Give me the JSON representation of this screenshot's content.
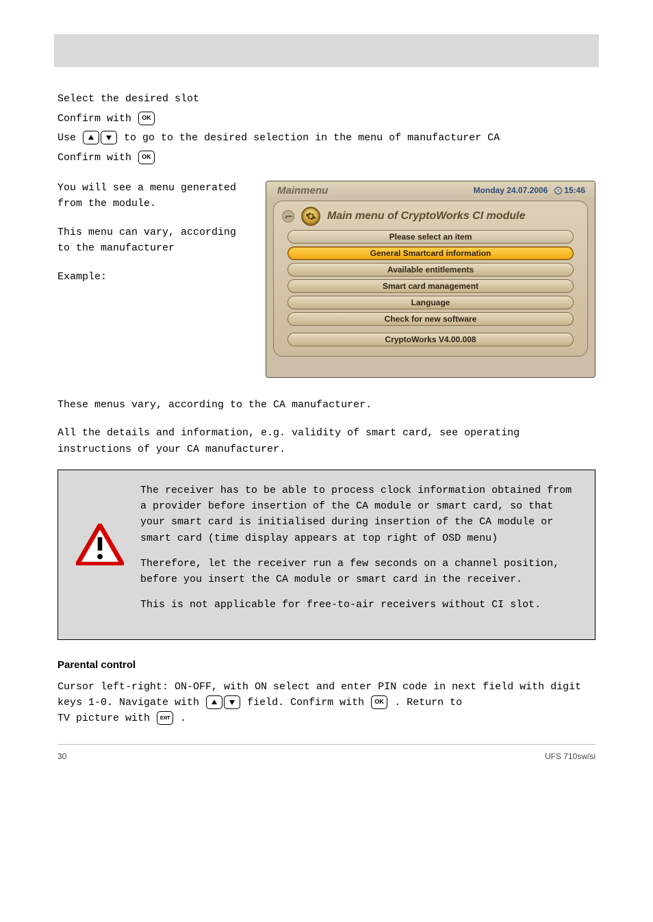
{
  "intro": {
    "line1": "Select the desired slot",
    "confirm": "Confirm with",
    "line2_a": "Use",
    "line2_b": "to go to the desired selection in the menu of manufacturer CA",
    "confirm2": "Confirm with"
  },
  "left_col": {
    "line1": "You will see a menu generated from the module.",
    "line2": "This menu can vary, according to the manufacturer",
    "example_label": "Example:"
  },
  "ui": {
    "tab": "Mainmenu",
    "date": "Monday 24.07.2006",
    "time": "15:46",
    "heading": "Main menu of CryptoWorks CI module",
    "prompt": "Please select an item",
    "items": [
      "General Smartcard information",
      "Available entitlements",
      "Smart card management",
      "Language",
      "Check for new software"
    ],
    "version": "CryptoWorks V4.00.008"
  },
  "mid": {
    "l1": "These menus vary, according to the CA manufacturer.",
    "l2": "All the details and information, e.g. validity of smart card, see operating instructions of your CA manufacturer."
  },
  "warn": {
    "p1": "The receiver has to be able to process clock information obtained from a provider before insertion of the CA module or smart card, so that your smart card is initialised during insertion of the CA module or smart card (time display appears at top right of OSD menu)",
    "p2": "Therefore, let the receiver run a few seconds on a channel position, before you insert the CA module or smart card in the receiver.",
    "p3": "This is not applicable for free-to-air receivers without CI slot."
  },
  "parental": {
    "heading": "Parental control",
    "p1_a": "Cursor left-right: ON-OFF, with ON select and enter PIN code in next field with digit keys 1-0. Navigate with",
    "p1_b": "field. Confirm with",
    "p1_c": ". Return to",
    "p1_d": "TV picture with",
    "p1_e": "."
  },
  "footer": {
    "page": "30",
    "doc": "UFS 710sw/si"
  }
}
